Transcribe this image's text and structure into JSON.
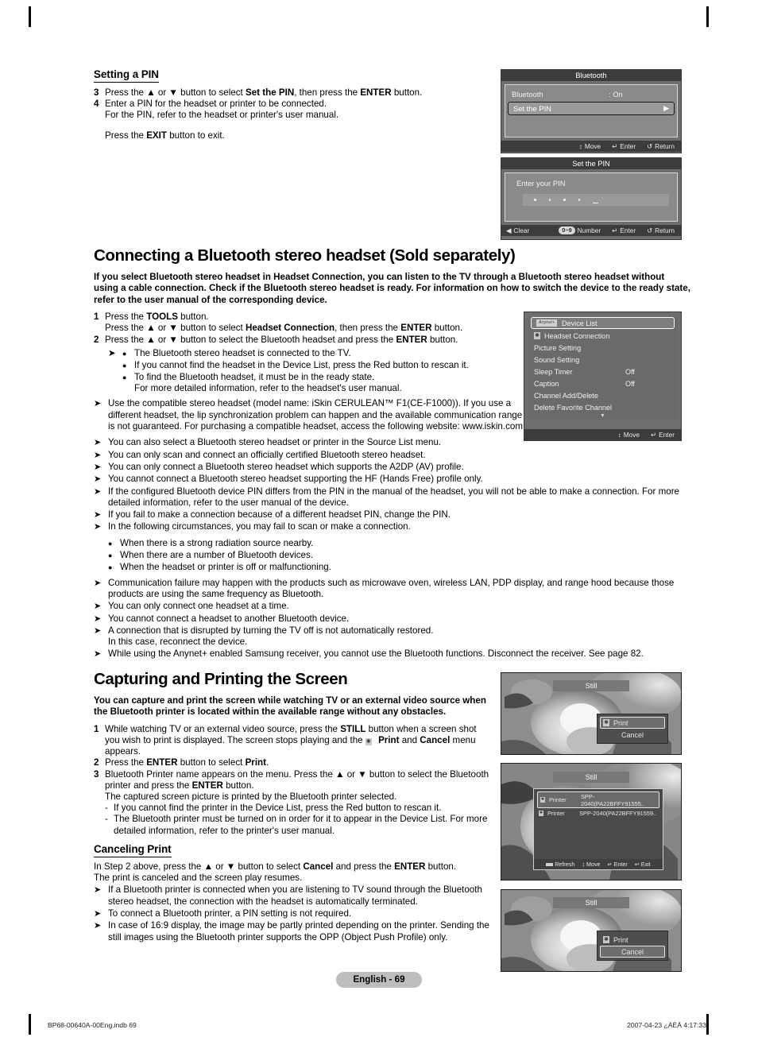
{
  "footer": {
    "page_badge": "English - 69",
    "file_ref": "BP68-00640A-00Eng.indb   69",
    "timestamp": "2007-04-23   ¿ÀÈÄ 4:17:33"
  },
  "section_pin": {
    "heading": "Setting a PIN",
    "steps": [
      {
        "num": "3",
        "text_html": "Press the ▲ or ▼ button to select <b>Set the PIN</b>, then press the <b>ENTER</b> button."
      },
      {
        "num": "4",
        "text_html": "Enter a PIN for the headset or printer to be connected.<br>For the PIN, refer to the headset or printer's user manual."
      }
    ],
    "exit_note_html": "Press the <b>EXIT</b> button to exit."
  },
  "osd_bluetooth": {
    "title": "Bluetooth",
    "row_label": "Bluetooth",
    "row_value": ": On",
    "selected_item": "Set the PIN",
    "arrow_glyph": "▶",
    "footer": [
      {
        "icon": "↕",
        "label": "Move"
      },
      {
        "icon": "↵",
        "label": "Enter"
      },
      {
        "icon": "↺",
        "label": "Return"
      }
    ]
  },
  "osd_setpin": {
    "title": "Set the PIN",
    "prompt": "Enter your PIN",
    "dots": 4,
    "footer_left": {
      "icon": "◀",
      "label": "Clear"
    },
    "footer": [
      {
        "icon": "0~9",
        "label": "Number",
        "badge": true
      },
      {
        "icon": "↵",
        "label": "Enter"
      },
      {
        "icon": "↺",
        "label": "Return"
      }
    ]
  },
  "section_headset": {
    "heading": "Connecting a Bluetooth stereo headset (Sold separately)",
    "intro": "If you select Bluetooth stereo headset in Headset Connection, you can listen to the TV through a Bluetooth stereo headset without using a cable connection. Check if the Bluetooth stereo headset is ready. For information on how to switch the device to the ready state, refer to the user manual of the corresponding device.",
    "steps": [
      {
        "num": "1",
        "text_html": "Press the <b>TOOLS</b> button.<br>Press the ▲ or ▼ button to select <b>Headset Connection</b>, then press the <b>ENTER</b> button."
      },
      {
        "num": "2",
        "text_html": "Press the ▲ or ▼ button to select the Bluetooth headset and press the <b>ENTER</b> button."
      }
    ],
    "nested_bullets": [
      "The Bluetooth stereo headset is connected to the TV.",
      "If you cannot find the headset in the Device List, press the Red button to rescan it.",
      "To find the Bluetooth headset, it must be in the ready state.<br>For more detailed information, refer to the headset's user manual."
    ],
    "notes": [
      "Use the compatible stereo headset (model name: iSkin CERULEAN™ F1(CE-F1000)). If you use a different headset, the lip synchronization problem can happen and the available communication range is not guaranteed. For purchasing a compatible headset, access the following website: www.iskin.com",
      "You can also select a Bluetooth stereo headset or printer in the Source List menu.",
      "You can only scan and connect an officially certified Bluetooth stereo headset.",
      "You can only connect a Bluetooth stereo headset which supports the A2DP (AV) profile.",
      "You cannot connect a Bluetooth stereo headset supporting the HF (Hands Free) profile only.",
      "If the configured Bluetooth device PIN differs from the PIN in the manual of the headset, you will not be able to make a connection. For more detailed information, refer to the user manual of the device.",
      "If you fail to make a connection because of a different headset PIN, change the PIN.",
      "In the following circumstances, you may fail to scan or make a connection."
    ],
    "circumstances": [
      "When there is a strong radiation source nearby.",
      "When there are a number of Bluetooth devices.",
      "When the headset or printer is off or malfunctioning."
    ],
    "notes2": [
      "Communication failure may happen with the products such as microwave oven, wireless LAN, PDP display, and range hood because those products are using the same frequency as Bluetooth.",
      "You can only connect one headset at a time.",
      "You cannot connect a headset to another Bluetooth device.",
      "A connection that is disrupted by turning the TV off is not automatically restored.<br>In this case, reconnect the device.",
      "While using the Anynet+ enabled Samsung receiver, you cannot use the Bluetooth functions. Disconnect the receiver. See page 82."
    ]
  },
  "osd_devicelist": {
    "selected_item": "Device List",
    "selected_icon_label": "Anynet+",
    "items": [
      {
        "label": "Headset Connection",
        "value": "",
        "icon": true
      },
      {
        "label": "Picture Setting",
        "value": "",
        "icon": false
      },
      {
        "label": "Sound Setting",
        "value": "",
        "icon": false
      },
      {
        "label": "Sleep Timer",
        "value": "Off",
        "icon": false
      },
      {
        "label": "Caption",
        "value": "Off",
        "icon": false
      },
      {
        "label": "Channel Add/Delete",
        "value": "",
        "icon": false
      },
      {
        "label": "Delete Favorite Channel",
        "value": "",
        "icon": false
      }
    ],
    "scroll_glyph": "▼",
    "footer": [
      {
        "icon": "↕",
        "label": "Move"
      },
      {
        "icon": "↵",
        "label": "Enter"
      }
    ]
  },
  "section_capture": {
    "heading": "Capturing and Printing the Screen",
    "intro": "You can capture and print the screen while watching TV or an external video source when the Bluetooth printer is located within the available range without any obstacles.",
    "steps": [
      {
        "num": "1",
        "text_html": "While watching TV or an external video source, press the <b>STILL</b> button when a screen shot you wish to print is displayed. The screen stops playing and the <span class=\"bticon\" style=\"display:inline-block\">✱</span> <b>Print</b> and <b>Cancel</b> menu appears."
      },
      {
        "num": "2",
        "text_html": "Press the <b>ENTER</b> button to select <b>Print</b>."
      },
      {
        "num": "3",
        "text_html": "Bluetooth Printer name appears on the menu. Press the ▲ or ▼ button to select the Bluetooth printer and press the <b>ENTER</b> button.<br>The captured screen picture is printed by the Bluetooth printer selected."
      }
    ],
    "dashes": [
      "If you cannot find the printer in the Device List, press the Red button to rescan it.",
      "The Bluetooth printer must be turned on in order for it to appear in the Device List. For more detailed information, refer to the printer's user manual."
    ]
  },
  "section_cancel": {
    "heading": "Canceling Print",
    "intro_html": "In Step 2 above, press the ▲ or ▼ button to select <b>Cancel</b> and press the <b>ENTER</b> button.<br>The print is canceled and the screen play resumes.",
    "notes": [
      "If a Bluetooth printer is connected when you are listening to TV sound through the Bluetooth stereo headset, the connection with the headset is automatically terminated.",
      "To connect a Bluetooth printer, a PIN setting is not required.",
      "In case of 16:9 display, the image may be partly printed depending on the printer. Sending the still images using the Bluetooth printer supports the OPP (Object Push Profile) only."
    ]
  },
  "shot_print": {
    "still_label": "Still",
    "items": [
      {
        "label": "Print",
        "selected": true,
        "icon": true
      },
      {
        "label": "Cancel",
        "selected": false,
        "icon": false
      }
    ]
  },
  "shot_devices": {
    "still_label": "Still",
    "rows": [
      {
        "name": "Printer",
        "value": "SPP-2040(PA22BFFY91555..",
        "selected": true
      },
      {
        "name": "Printer",
        "value": "SPP-2040(PA22BFFY91559..",
        "selected": false
      }
    ],
    "footer": [
      {
        "icon": "red",
        "label": "Refresh"
      },
      {
        "icon": "↕",
        "label": "Move"
      },
      {
        "icon": "↵",
        "label": "Enter"
      },
      {
        "icon": "↩",
        "label": "Exit"
      }
    ]
  },
  "shot_cancel": {
    "still_label": "Still",
    "items": [
      {
        "label": "Print",
        "selected": false,
        "icon": true
      },
      {
        "label": "Cancel",
        "selected": true,
        "icon": false
      }
    ]
  }
}
